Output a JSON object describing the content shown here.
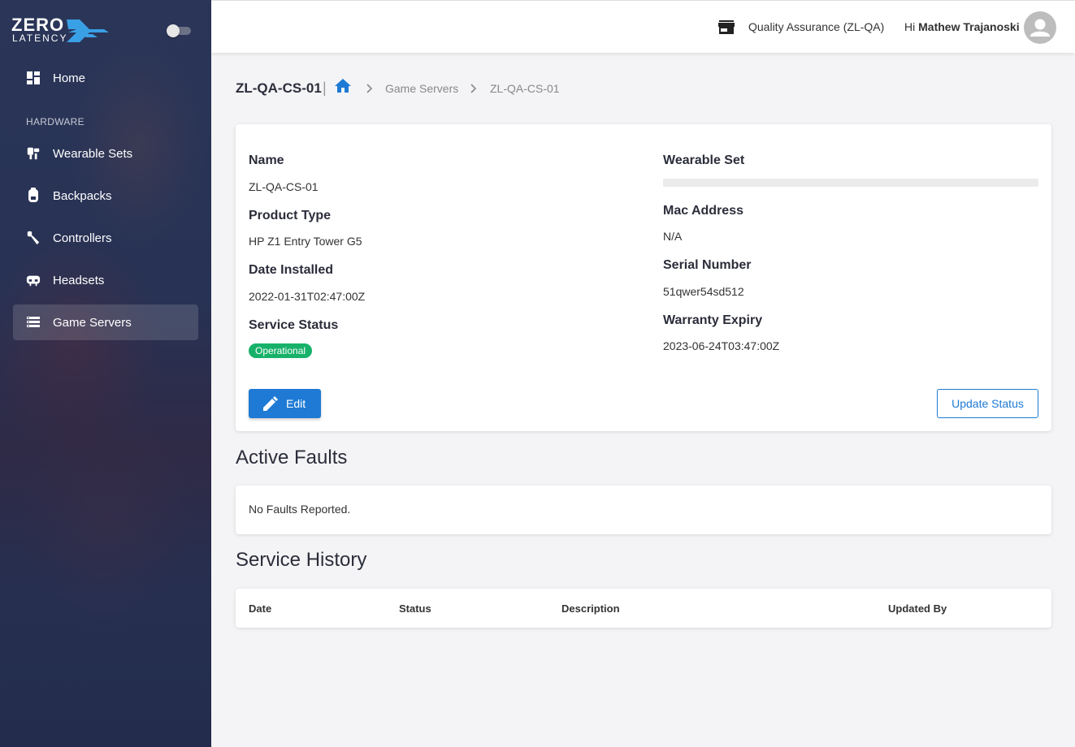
{
  "brand": {
    "line1": "ZERO",
    "line2": "LATENCY",
    "accent": "#3aa0e6"
  },
  "sidebar": {
    "section_label": "HARDWARE",
    "items": [
      {
        "label": "Home",
        "icon": "dashboard-icon"
      },
      {
        "label": "Wearable Sets",
        "icon": "wearable-set-icon"
      },
      {
        "label": "Backpacks",
        "icon": "backpack-icon"
      },
      {
        "label": "Controllers",
        "icon": "controller-icon"
      },
      {
        "label": "Headsets",
        "icon": "headset-icon"
      },
      {
        "label": "Game Servers",
        "icon": "server-icon",
        "active": true
      }
    ]
  },
  "header": {
    "org": "Quality Assurance (ZL-QA)",
    "greeting_prefix": "Hi",
    "user_name": "Mathew Trajanoski"
  },
  "breadcrumb": {
    "title": "ZL-QA-CS-01",
    "separator": "|",
    "items": [
      "Game Servers",
      "ZL-QA-CS-01"
    ]
  },
  "details": {
    "name_label": "Name",
    "name_value": "ZL-QA-CS-01",
    "product_type_label": "Product Type",
    "product_type_value": "HP Z1 Entry Tower G5",
    "date_installed_label": "Date Installed",
    "date_installed_value": "2022-01-31T02:47:00Z",
    "service_status_label": "Service Status",
    "service_status_value": "Operational",
    "wearable_set_label": "Wearable Set",
    "mac_address_label": "Mac Address",
    "mac_address_value": "N/A",
    "serial_number_label": "Serial Number",
    "serial_number_value": "51qwer54sd512",
    "warranty_expiry_label": "Warranty Expiry",
    "warranty_expiry_value": "2023-06-24T03:47:00Z",
    "edit_label": "Edit",
    "update_status_label": "Update Status"
  },
  "active_faults": {
    "title": "Active Faults",
    "empty_text": "No Faults Reported."
  },
  "service_history": {
    "title": "Service History",
    "columns": [
      "Date",
      "Status",
      "Description",
      "Updated By"
    ]
  },
  "colors": {
    "primary": "#1e7ad4",
    "success": "#17b169",
    "sidebar": "#273254"
  }
}
